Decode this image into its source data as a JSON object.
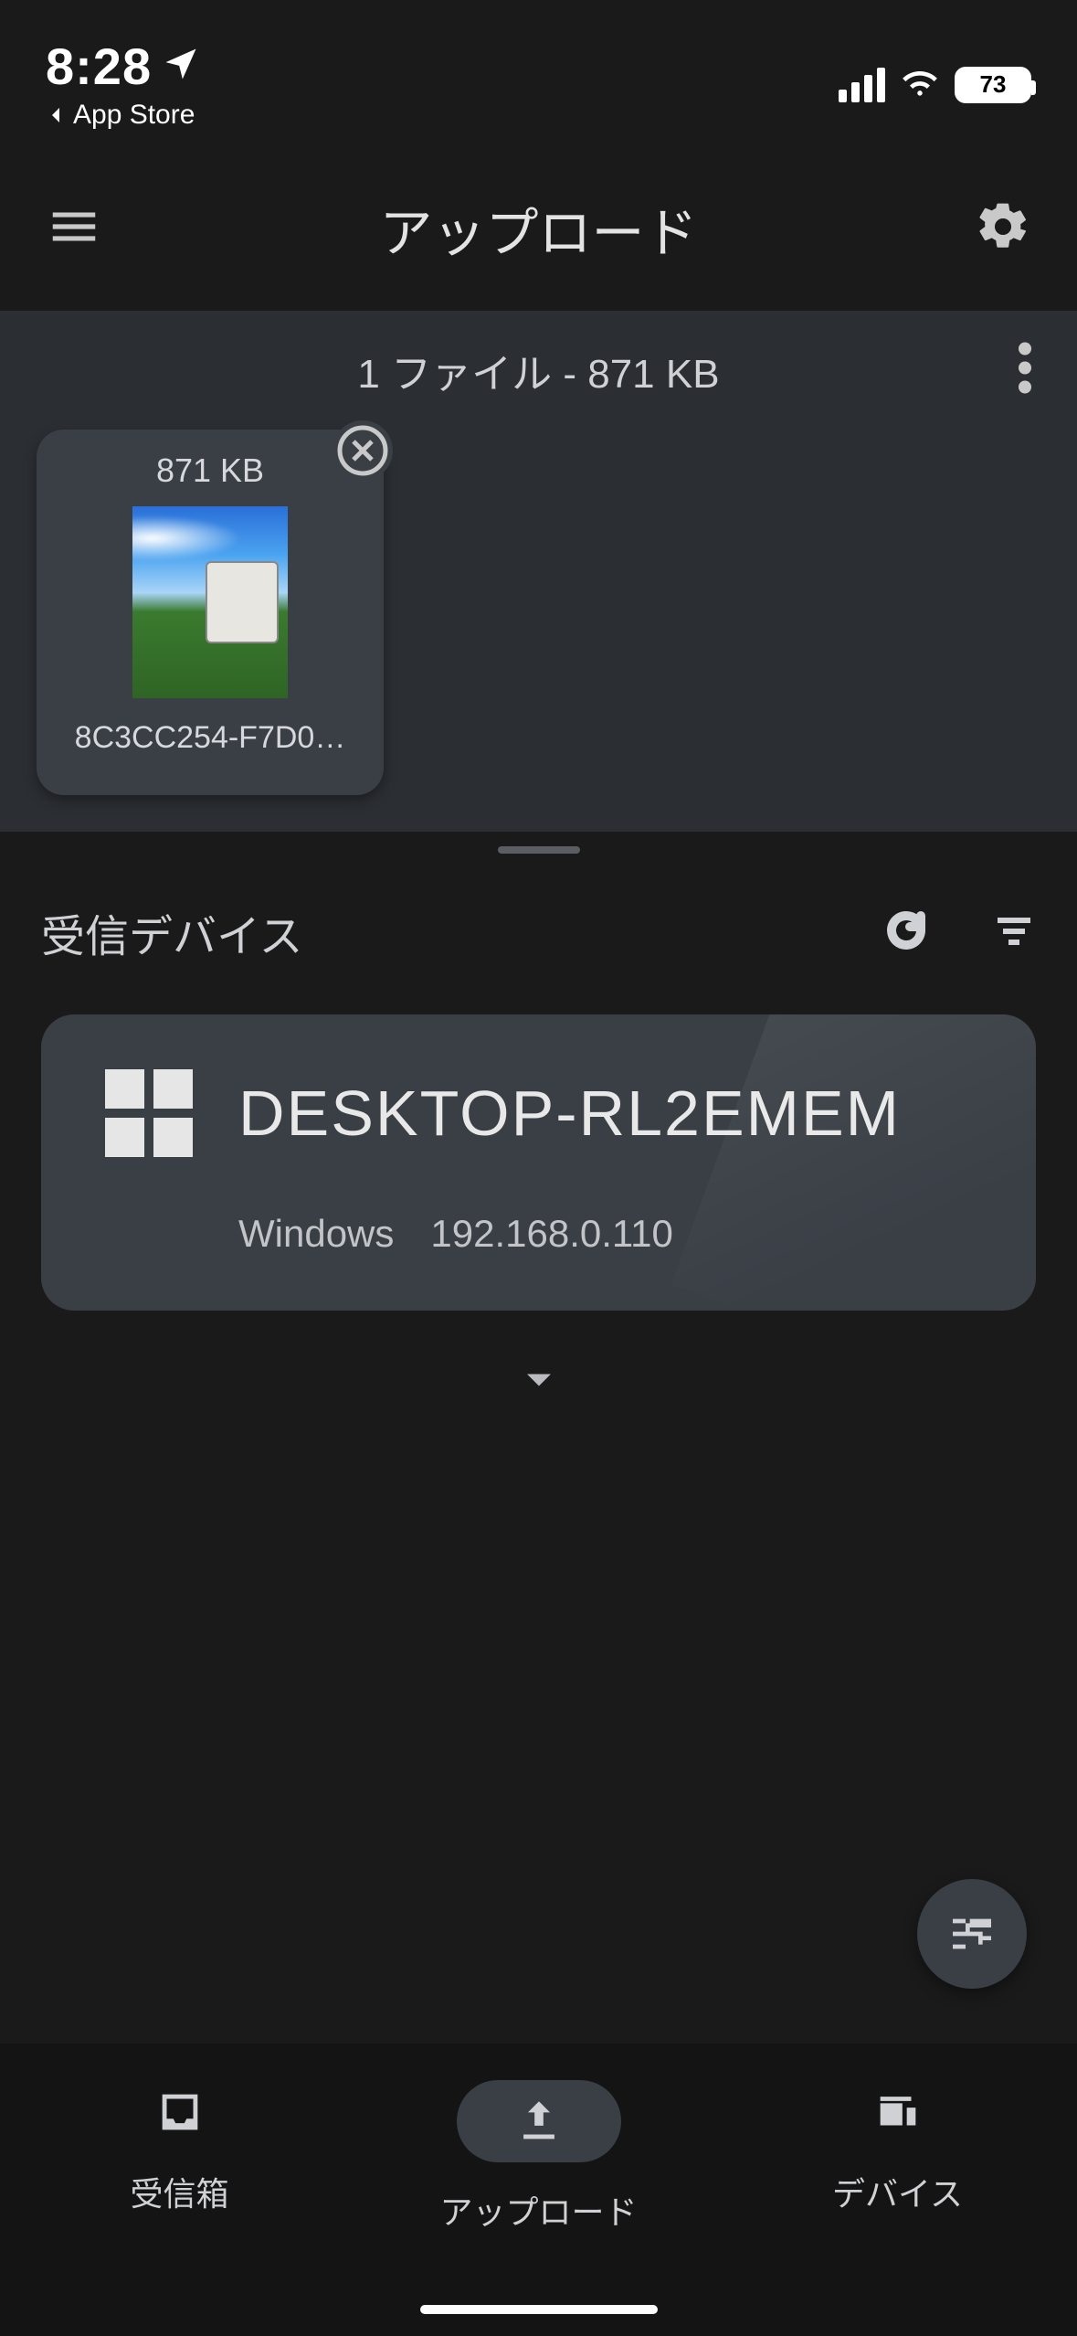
{
  "status": {
    "time": "8:28",
    "back_label": "App Store",
    "battery_pct": "73"
  },
  "header": {
    "title": "アップロード"
  },
  "files": {
    "summary": "1 ファイル - 871 KB",
    "items": [
      {
        "size": "871 KB",
        "name": "8C3CC254-F7D0…"
      }
    ]
  },
  "devices": {
    "section_title": "受信デバイス",
    "items": [
      {
        "name": "DESKTOP-RL2EMEM",
        "os": "Windows",
        "ip": "192.168.0.110"
      }
    ]
  },
  "nav": {
    "inbox": "受信箱",
    "upload": "アップロード",
    "devices": "デバイス"
  }
}
